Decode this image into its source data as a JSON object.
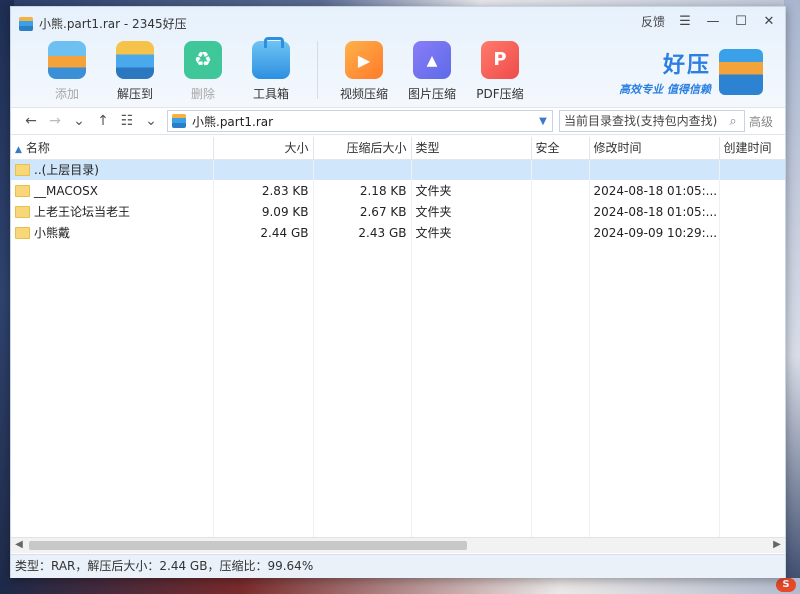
{
  "window": {
    "title": "小熊.part1.rar - 2345好压",
    "feedback": "反馈"
  },
  "toolbar": {
    "add": "添加",
    "extract": "解压到",
    "delete": "删除",
    "tools": "工具箱",
    "video": "视频压缩",
    "image": "图片压缩",
    "pdf": "PDF压缩"
  },
  "brand": {
    "name": "好压",
    "slogan": "高效专业 值得信赖"
  },
  "nav": {
    "path": "小熊.part1.rar",
    "search_placeholder": "当前目录查找(支持包内查找)",
    "advanced": "高级"
  },
  "table": {
    "headers": {
      "name": "名称",
      "size": "大小",
      "packed": "压缩后大小",
      "type": "类型",
      "security": "安全",
      "modified": "修改时间",
      "created": "创建时间"
    },
    "rows": [
      {
        "name": "..(上层目录)",
        "size": "",
        "packed": "",
        "type": "",
        "modified": ""
      },
      {
        "name": "__MACOSX",
        "size": "2.83 KB",
        "packed": "2.18 KB",
        "type": "文件夹",
        "modified": "2024-08-18 01:05:..."
      },
      {
        "name": "上老王论坛当老王",
        "size": "9.09 KB",
        "packed": "2.67 KB",
        "type": "文件夹",
        "modified": "2024-08-18 01:05:..."
      },
      {
        "name": "小熊戴",
        "size": "2.44 GB",
        "packed": "2.43 GB",
        "type": "文件夹",
        "modified": "2024-09-09 10:29:..."
      }
    ]
  },
  "status": {
    "text": "类型：RAR，解压后大小：2.44 GB，压缩比：99.64%"
  },
  "colors": {
    "accent": "#2b7fe0",
    "selection": "#cfe6fb"
  }
}
